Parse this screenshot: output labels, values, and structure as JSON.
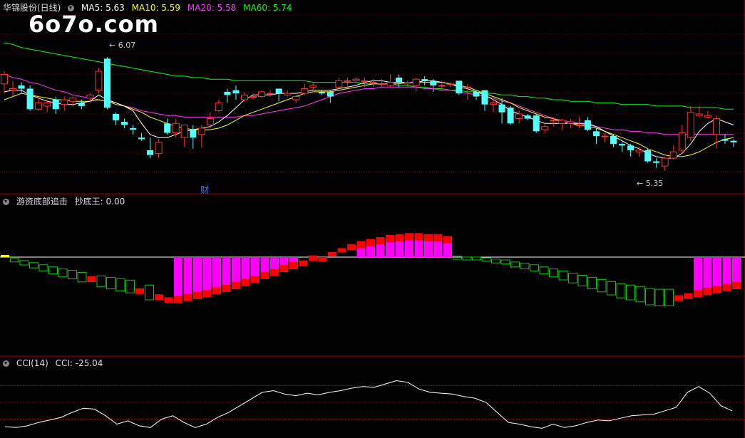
{
  "stock_panel": {
    "title": "华锦股份(日线)",
    "ma5_label": "MA5: 5.63",
    "ma10_label": "MA10: 5.59",
    "ma20_label": "MA20: 5.58",
    "ma60_label": "MA60: 5.74",
    "high_marker": "6.07",
    "low_marker": "5.35",
    "finance_marker": "财"
  },
  "indicator_panel": {
    "title": "游资底部追击",
    "value_label": "抄底王: 0.00"
  },
  "cci_panel": {
    "title": "CCI(14)",
    "value_label": "CCI: -25.04"
  },
  "watermark": "6o7o.com",
  "colors": {
    "up": "#ff3333",
    "down": "#54ffff",
    "ma5": "#ffffff",
    "ma10": "#ffff00",
    "ma20": "#ff33ff",
    "ma60": "#00ff00",
    "grid": "#8a0000",
    "cci": "#ffffff",
    "bar_green": "#00cc00",
    "bar_red": "#ff0000",
    "bar_magenta": "#ff00ff",
    "bar_yellow": "#ffff33"
  },
  "chart_data": [
    {
      "type": "candlestick",
      "ylim": [
        5.25,
        6.35
      ],
      "high_point": 6.07,
      "low_point": 5.35,
      "candles": [
        [
          5.9,
          5.96,
          5.84,
          5.98
        ],
        [
          5.86,
          5.87,
          5.82,
          5.92
        ],
        [
          5.89,
          5.87,
          5.84,
          5.91
        ],
        [
          5.87,
          5.74,
          5.73,
          5.89
        ],
        [
          5.74,
          5.78,
          5.73,
          5.82
        ],
        [
          5.76,
          5.78,
          5.72,
          5.8
        ],
        [
          5.8,
          5.74,
          5.71,
          5.82
        ],
        [
          5.77,
          5.8,
          5.73,
          5.82
        ],
        [
          5.79,
          5.81,
          5.76,
          5.82
        ],
        [
          5.78,
          5.76,
          5.74,
          5.8
        ],
        [
          5.81,
          5.83,
          5.78,
          5.84
        ],
        [
          5.86,
          5.98,
          5.84,
          6.0
        ],
        [
          6.06,
          5.75,
          5.74,
          6.07
        ],
        [
          5.71,
          5.67,
          5.64,
          5.72
        ],
        [
          5.66,
          5.64,
          5.62,
          5.68
        ],
        [
          5.62,
          5.61,
          5.58,
          5.64
        ],
        [
          5.56,
          5.55,
          5.54,
          5.59
        ],
        [
          5.48,
          5.45,
          5.43,
          5.56
        ],
        [
          5.46,
          5.53,
          5.43,
          5.55
        ],
        [
          5.65,
          5.59,
          5.58,
          5.68
        ],
        [
          5.59,
          5.65,
          5.56,
          5.68
        ],
        [
          5.56,
          5.64,
          5.5,
          5.64
        ],
        [
          5.61,
          5.56,
          5.49,
          5.64
        ],
        [
          5.58,
          5.62,
          5.5,
          5.64
        ],
        [
          5.64,
          5.68,
          5.62,
          5.72
        ],
        [
          5.73,
          5.78,
          5.72,
          5.8
        ],
        [
          5.85,
          5.83,
          5.78,
          5.87
        ],
        [
          5.86,
          5.84,
          5.8,
          5.89
        ],
        [
          5.8,
          5.83,
          5.79,
          5.85
        ],
        [
          5.82,
          5.82,
          5.8,
          5.84
        ],
        [
          5.82,
          5.85,
          5.81,
          5.86
        ],
        [
          5.84,
          5.84,
          5.82,
          5.86
        ],
        [
          5.87,
          5.84,
          5.79,
          5.87
        ],
        [
          5.83,
          5.84,
          5.82,
          5.86
        ],
        [
          5.8,
          5.82,
          5.78,
          5.83
        ],
        [
          5.84,
          5.87,
          5.83,
          5.9
        ],
        [
          5.88,
          5.89,
          5.86,
          5.91
        ],
        [
          5.85,
          5.84,
          5.83,
          5.86
        ],
        [
          5.85,
          5.82,
          5.78,
          5.86
        ],
        [
          5.88,
          5.92,
          5.87,
          5.94
        ],
        [
          5.92,
          5.92,
          5.89,
          5.94
        ],
        [
          5.92,
          5.93,
          5.91,
          5.94
        ],
        [
          5.92,
          5.92,
          5.88,
          5.94
        ],
        [
          5.91,
          5.91,
          5.88,
          5.93
        ],
        [
          5.9,
          5.9,
          5.88,
          5.93
        ],
        [
          5.89,
          5.91,
          5.88,
          5.96
        ],
        [
          5.94,
          5.91,
          5.88,
          5.96
        ],
        [
          5.9,
          5.91,
          5.88,
          5.92
        ],
        [
          5.89,
          5.93,
          5.85,
          5.94
        ],
        [
          5.93,
          5.92,
          5.89,
          5.95
        ],
        [
          5.92,
          5.89,
          5.85,
          5.93
        ],
        [
          5.89,
          5.89,
          5.86,
          5.92
        ],
        [
          5.9,
          5.9,
          5.88,
          5.91
        ],
        [
          5.92,
          5.84,
          5.83,
          5.92
        ],
        [
          5.88,
          5.88,
          5.8,
          5.9
        ],
        [
          5.85,
          5.82,
          5.8,
          5.86
        ],
        [
          5.86,
          5.77,
          5.73,
          5.86
        ],
        [
          5.77,
          5.78,
          5.72,
          5.8
        ],
        [
          5.77,
          5.72,
          5.65,
          5.81
        ],
        [
          5.75,
          5.65,
          5.64,
          5.76
        ],
        [
          5.68,
          5.71,
          5.65,
          5.73
        ],
        [
          5.7,
          5.68,
          5.67,
          5.71
        ],
        [
          5.7,
          5.6,
          5.59,
          5.71
        ],
        [
          5.61,
          5.63,
          5.59,
          5.65
        ],
        [
          5.67,
          5.67,
          5.63,
          5.69
        ],
        [
          5.65,
          5.67,
          5.61,
          5.68
        ],
        [
          5.65,
          5.66,
          5.62,
          5.68
        ],
        [
          5.64,
          5.64,
          5.62,
          5.69
        ],
        [
          5.67,
          5.61,
          5.6,
          5.69
        ],
        [
          5.6,
          5.57,
          5.52,
          5.62
        ],
        [
          5.57,
          5.57,
          5.53,
          5.59
        ],
        [
          5.57,
          5.52,
          5.5,
          5.58
        ],
        [
          5.52,
          5.51,
          5.47,
          5.53
        ],
        [
          5.51,
          5.48,
          5.44,
          5.52
        ],
        [
          5.47,
          5.48,
          5.44,
          5.5
        ],
        [
          5.48,
          5.41,
          5.4,
          5.49
        ],
        [
          5.41,
          5.4,
          5.37,
          5.43
        ],
        [
          5.38,
          5.43,
          5.35,
          5.44
        ],
        [
          5.43,
          5.47,
          5.42,
          5.51
        ],
        [
          5.48,
          5.59,
          5.46,
          5.64
        ],
        [
          5.56,
          5.72,
          5.54,
          5.76
        ],
        [
          5.7,
          5.71,
          5.69,
          5.76
        ],
        [
          5.69,
          5.7,
          5.68,
          5.73
        ],
        [
          5.58,
          5.68,
          5.49,
          5.7
        ],
        [
          5.55,
          5.54,
          5.52,
          5.58
        ],
        [
          5.54,
          5.53,
          5.5,
          5.55
        ]
      ],
      "ma5": [
        5.85,
        5.86,
        5.86,
        5.83,
        5.81,
        5.79,
        5.78,
        5.77,
        5.77,
        5.78,
        5.79,
        5.83,
        5.8,
        5.78,
        5.76,
        5.73,
        5.65,
        5.58,
        5.56,
        5.56,
        5.58,
        5.6,
        5.61,
        5.62,
        5.63,
        5.66,
        5.7,
        5.75,
        5.8,
        5.83,
        5.83,
        5.83,
        5.84,
        5.84,
        5.84,
        5.85,
        5.86,
        5.86,
        5.86,
        5.87,
        5.88,
        5.89,
        5.91,
        5.92,
        5.92,
        5.91,
        5.91,
        5.91,
        5.91,
        5.92,
        5.92,
        5.91,
        5.9,
        5.88,
        5.87,
        5.85,
        5.83,
        5.8,
        5.77,
        5.73,
        5.71,
        5.69,
        5.67,
        5.65,
        5.65,
        5.65,
        5.65,
        5.65,
        5.65,
        5.63,
        5.6,
        5.57,
        5.54,
        5.51,
        5.49,
        5.46,
        5.44,
        5.43,
        5.43,
        5.46,
        5.52,
        5.6,
        5.65,
        5.68,
        5.66,
        5.64
      ],
      "ma10": [
        5.8,
        5.82,
        5.84,
        5.83,
        5.82,
        5.81,
        5.8,
        5.8,
        5.79,
        5.79,
        5.79,
        5.8,
        5.79,
        5.77,
        5.76,
        5.74,
        5.72,
        5.69,
        5.67,
        5.65,
        5.63,
        5.62,
        5.61,
        5.61,
        5.61,
        5.62,
        5.64,
        5.67,
        5.7,
        5.72,
        5.74,
        5.76,
        5.78,
        5.8,
        5.82,
        5.84,
        5.85,
        5.85,
        5.85,
        5.86,
        5.87,
        5.88,
        5.89,
        5.9,
        5.9,
        5.9,
        5.9,
        5.91,
        5.91,
        5.91,
        5.91,
        5.91,
        5.9,
        5.89,
        5.88,
        5.86,
        5.84,
        5.82,
        5.8,
        5.78,
        5.75,
        5.73,
        5.71,
        5.69,
        5.68,
        5.66,
        5.65,
        5.64,
        5.63,
        5.62,
        5.6,
        5.58,
        5.56,
        5.54,
        5.52,
        5.49,
        5.47,
        5.45,
        5.44,
        5.44,
        5.45,
        5.47,
        5.5,
        5.53,
        5.55,
        5.56
      ],
      "ma20": [
        5.96,
        5.94,
        5.93,
        5.91,
        5.9,
        5.88,
        5.86,
        5.85,
        5.83,
        5.82,
        5.81,
        5.8,
        5.79,
        5.78,
        5.76,
        5.75,
        5.73,
        5.72,
        5.71,
        5.7,
        5.7,
        5.69,
        5.69,
        5.69,
        5.69,
        5.69,
        5.69,
        5.69,
        5.7,
        5.7,
        5.71,
        5.72,
        5.73,
        5.74,
        5.75,
        5.76,
        5.78,
        5.8,
        5.82,
        5.84,
        5.85,
        5.86,
        5.87,
        5.87,
        5.88,
        5.88,
        5.88,
        5.88,
        5.88,
        5.87,
        5.87,
        5.86,
        5.86,
        5.85,
        5.84,
        5.83,
        5.82,
        5.81,
        5.79,
        5.78,
        5.76,
        5.74,
        5.72,
        5.7,
        5.68,
        5.67,
        5.66,
        5.65,
        5.64,
        5.63,
        5.62,
        5.61,
        5.61,
        5.6,
        5.6,
        5.59,
        5.59,
        5.58,
        5.58,
        5.58,
        5.58,
        5.58,
        5.58,
        5.58,
        5.58,
        5.58
      ],
      "ma60": [
        6.16,
        6.15,
        6.13,
        6.12,
        6.11,
        6.1,
        6.09,
        6.08,
        6.07,
        6.06,
        6.05,
        6.04,
        6.03,
        6.02,
        6.01,
        6.0,
        5.99,
        5.98,
        5.97,
        5.96,
        5.95,
        5.95,
        5.94,
        5.94,
        5.93,
        5.93,
        5.93,
        5.92,
        5.92,
        5.92,
        5.92,
        5.92,
        5.92,
        5.92,
        5.92,
        5.92,
        5.91,
        5.91,
        5.91,
        5.91,
        5.91,
        5.91,
        5.9,
        5.9,
        5.9,
        5.9,
        5.89,
        5.89,
        5.88,
        5.88,
        5.87,
        5.87,
        5.86,
        5.86,
        5.85,
        5.85,
        5.84,
        5.84,
        5.83,
        5.83,
        5.82,
        5.82,
        5.81,
        5.81,
        5.8,
        5.8,
        5.79,
        5.79,
        5.79,
        5.78,
        5.78,
        5.78,
        5.77,
        5.77,
        5.77,
        5.77,
        5.76,
        5.76,
        5.76,
        5.76,
        5.75,
        5.75,
        5.75,
        5.75,
        5.74,
        5.74
      ]
    },
    {
      "type": "bar",
      "ylim": [
        -0.6,
        0.35
      ],
      "values": [
        0.02,
        -0.02,
        -0.05,
        -0.08,
        -0.11,
        -0.14,
        -0.17,
        -0.19,
        -0.22,
        -0.25,
        -0.27,
        -0.29,
        -0.31,
        -0.33,
        -0.37,
        -0.4,
        -0.43,
        -0.46,
        -0.46,
        -0.44,
        -0.42,
        -0.4,
        -0.37,
        -0.35,
        -0.32,
        -0.29,
        -0.26,
        -0.22,
        -0.19,
        -0.15,
        -0.12,
        -0.09,
        -0.04,
        0.0,
        0.05,
        0.09,
        0.13,
        0.16,
        0.18,
        0.2,
        0.22,
        0.23,
        0.24,
        0.24,
        0.23,
        0.23,
        0.21,
        0.01,
        0.0,
        0.0,
        -0.01,
        -0.03,
        -0.04,
        -0.07,
        -0.09,
        -0.11,
        -0.14,
        -0.17,
        -0.2,
        -0.23,
        -0.26,
        -0.29,
        -0.32,
        -0.35,
        -0.38,
        -0.4,
        -0.42,
        -0.45,
        -0.46,
        -0.46,
        -0.44,
        -0.42,
        -0.4,
        -0.38,
        -0.36,
        -0.34,
        -0.32
      ],
      "kinds": [
        "y",
        "g",
        "g",
        "g",
        "g",
        "g",
        "g",
        "g",
        "g",
        "r",
        "g",
        "g",
        "g",
        "g",
        "r",
        "g",
        "r",
        "r",
        "m",
        "m",
        "m",
        "m",
        "m",
        "m",
        "m",
        "m",
        "m",
        "m",
        "m",
        "m",
        "m",
        "r",
        "r",
        "r",
        "r",
        "r",
        "r",
        "m",
        "m",
        "m",
        "m",
        "m",
        "m",
        "m",
        "m",
        "m",
        "m",
        "g",
        "g",
        "g",
        "g",
        "g",
        "g",
        "g",
        "g",
        "g",
        "g",
        "g",
        "g",
        "g",
        "g",
        "g",
        "g",
        "g",
        "g",
        "g",
        "g",
        "g",
        "g",
        "g",
        "r",
        "r",
        "m",
        "m",
        "m",
        "m",
        "m"
      ],
      "tops": [
        0,
        0,
        0,
        0,
        0,
        0,
        0,
        0,
        0,
        0,
        0,
        0,
        0,
        0,
        0,
        0,
        0,
        0,
        0,
        0,
        0,
        0,
        0,
        0,
        0,
        0,
        0,
        0,
        0,
        0,
        0,
        0,
        0,
        0,
        0,
        0,
        0,
        0,
        0,
        0,
        0,
        0,
        0,
        0,
        0,
        0,
        0,
        0,
        0,
        0,
        0,
        0,
        0,
        0,
        0,
        0,
        0,
        0,
        0,
        0,
        0,
        0,
        0,
        0,
        0,
        0,
        0,
        0,
        0,
        0,
        0,
        0,
        0,
        0,
        0,
        0,
        0
      ]
    },
    {
      "type": "line",
      "ylim": [
        -200,
        200
      ],
      "values": [
        -145,
        -150,
        -140,
        -120,
        -105,
        -90,
        -60,
        -35,
        -40,
        -80,
        -130,
        -110,
        -140,
        -150,
        -100,
        -80,
        -120,
        -150,
        -130,
        -90,
        -60,
        -20,
        20,
        60,
        70,
        50,
        40,
        55,
        45,
        60,
        70,
        85,
        95,
        90,
        110,
        130,
        120,
        80,
        60,
        55,
        50,
        35,
        25,
        0,
        -60,
        -120,
        -130,
        -145,
        -155,
        -130,
        -150,
        -140,
        -120,
        -105,
        -110,
        -95,
        -80,
        -75,
        -70,
        -50,
        -30,
        60,
        95,
        55,
        -20,
        -50
      ],
      "hlines": [
        100,
        0,
        -100
      ]
    }
  ]
}
